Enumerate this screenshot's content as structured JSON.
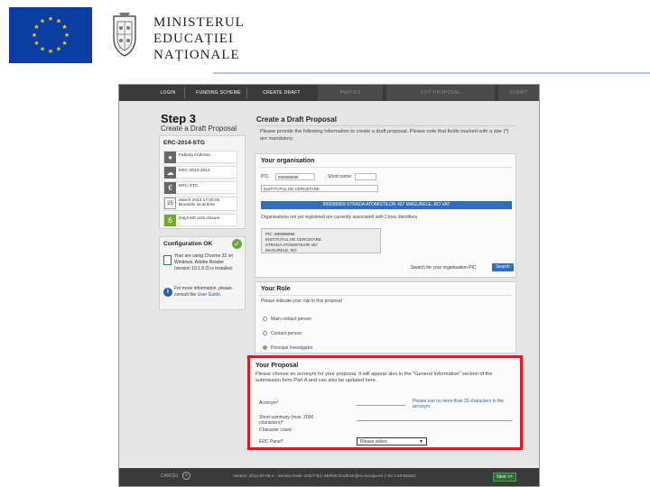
{
  "header": {
    "ministry_lines": [
      "MINISTERUL",
      "EDUCAȚIEI",
      "NAȚIONALE"
    ]
  },
  "wizard": {
    "tabs": [
      {
        "label": "LOGIN",
        "state": "done"
      },
      {
        "label": "FUNDING SCHEME",
        "state": "done"
      },
      {
        "label": "CREATE DRAFT",
        "state": "current"
      },
      {
        "label": "PARTIES",
        "state": "disabled"
      },
      {
        "label": "EDIT PROPOSAL",
        "state": "disabled"
      },
      {
        "label": "SUBMIT",
        "state": "disabled"
      }
    ]
  },
  "left": {
    "step_title": "Step 3",
    "step_subtitle": "Create a Draft Proposal",
    "summary_header": "ERC-2014-STG",
    "summary_items": [
      {
        "icon": "person-icon",
        "text": "Fabiola Andreea"
      },
      {
        "icon": "cloud-icon",
        "text": "ERC-2013-2014"
      },
      {
        "icon": "euro-icon",
        "text": "ERC-STG"
      },
      {
        "icon": "calendar-icon",
        "text": "March 2014 17:00:00\nBrussels local time",
        "day": "25"
      },
      {
        "icon": "days-icon",
        "text": "Days left until closure",
        "day": "6"
      }
    ],
    "config_title": "Configuration OK",
    "config_text": "Your are using Chrome 32 on Windows. Adobe Reader (version 10.1.8.0) is installed.",
    "help_text_pre": "For more information, please consult the ",
    "help_link": "User Guide"
  },
  "main": {
    "title": "Create a Draft Proposal",
    "intro": "Please provide the following information to create a draft proposal. Please note that fields marked with a star (*) are mandatory.",
    "org": {
      "header": "Your organisation",
      "pic_label": "PIC:",
      "pic_value": "999999999",
      "short_name_label": "Short name:",
      "legal_name": "INSTITUTUL DE CERCETARE",
      "banner": "999999999 STRADA ATOMISTILOR 407 MAGURELE, RO VAT",
      "note": "Organisations not yet registered are currently associated with Cross Identifiers",
      "address": [
        "PIC: 999999999",
        "INSTITUTUL DE CERCETARE",
        "STRADA ATOMISTILOR 407",
        "MAGURELE, RO"
      ],
      "search_text": "Search for your organisation PIC",
      "search_button": "Search"
    },
    "role": {
      "header": "Your Role",
      "intro": "Please indicate your role in this proposal",
      "options": [
        {
          "label": "Main contact person",
          "selected": false
        },
        {
          "label": "Contact person",
          "selected": false
        },
        {
          "label": "Principal Investigator",
          "selected": true
        }
      ]
    },
    "proposal": {
      "header": "Your Proposal",
      "intro": "Please choose an acronym for your proposal. It will appear also in the \"General Information\" section of the submission form Part A and can also be updated here.",
      "acronym_label": "Acronym*",
      "acronym_note": "Please use no more than 20 characters in the acronym.",
      "summary_label": "Short summary (max. 2000 characters)*",
      "count_label": "Character count:",
      "panel_label": "ERC Panel*",
      "panel_select": "Please select"
    }
  },
  "footer": {
    "cancel": "CANCEL",
    "version": "Version: 2014-02-06-2 - Service Desk: DIGIT-EC-SERVICE-DESK@ec.europa.eu (+32 2 29 58181)",
    "next": "Next >>"
  }
}
